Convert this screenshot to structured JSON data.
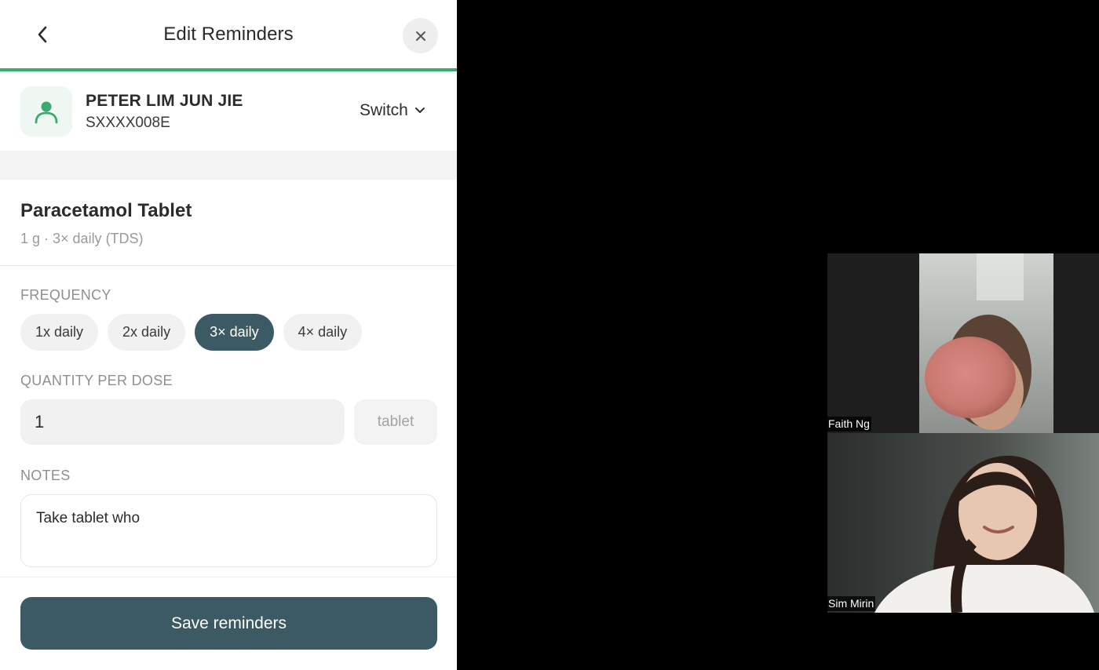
{
  "header": {
    "title": "Edit Reminders",
    "back_icon": "chevron-left-icon",
    "close_icon": "close-icon"
  },
  "patient": {
    "name": "PETER LIM JUN JIE",
    "id": "SXXXX008E",
    "switch_label": "Switch",
    "avatar_icon": "user-icon"
  },
  "medication": {
    "name": "Paracetamol Tablet",
    "dosage_summary": "1 g · 3× daily (TDS)"
  },
  "frequency": {
    "label": "FREQUENCY",
    "options": [
      "1x daily",
      "2x daily",
      "3× daily",
      "4× daily"
    ],
    "selected_index": 2
  },
  "quantity": {
    "label": "QUANTITY PER DOSE",
    "value": "1",
    "unit": "tablet"
  },
  "notes": {
    "label": "NOTES",
    "value": "Take tablet who"
  },
  "footer": {
    "save_label": "Save reminders"
  },
  "video_call": {
    "participants": [
      {
        "name": "Faith Ng"
      },
      {
        "name": "Sim Mirin"
      }
    ]
  },
  "colors": {
    "accent": "#3aaa6e",
    "primary": "#3b5a63",
    "avatar_bg": "#eef7f1",
    "background_right": "#000000"
  }
}
